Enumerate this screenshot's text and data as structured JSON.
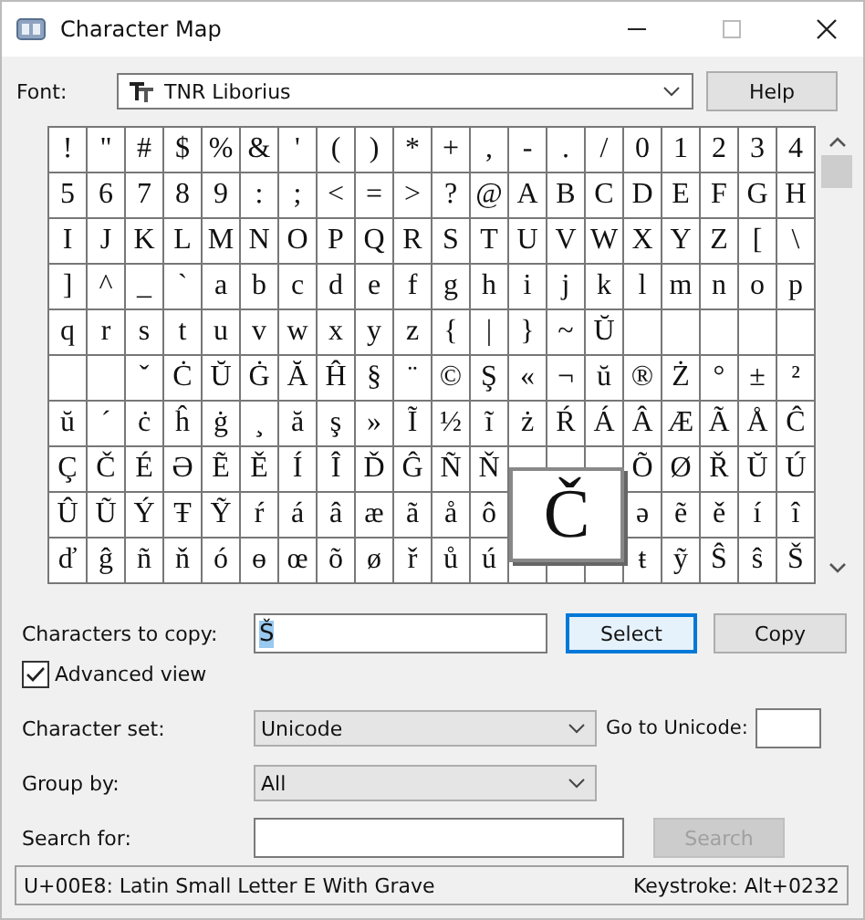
{
  "window": {
    "title": "Character Map"
  },
  "font": {
    "label": "Font:",
    "value": "TNR Liborius"
  },
  "help_button": {
    "label": "Help"
  },
  "grid": {
    "rows": [
      [
        "!",
        "\"",
        "#",
        "$",
        "%",
        "&",
        "'",
        "(",
        ")",
        "*",
        "+",
        ",",
        "-",
        ".",
        "/",
        "0",
        "1",
        "2",
        "3",
        "4"
      ],
      [
        "5",
        "6",
        "7",
        "8",
        "9",
        ":",
        ";",
        "<",
        "=",
        ">",
        "?",
        "@",
        "A",
        "B",
        "C",
        "D",
        "E",
        "F",
        "G",
        "H"
      ],
      [
        "I",
        "J",
        "K",
        "L",
        "M",
        "N",
        "O",
        "P",
        "Q",
        "R",
        "S",
        "T",
        "U",
        "V",
        "W",
        "X",
        "Y",
        "Z",
        "[",
        "\\"
      ],
      [
        "]",
        "^",
        "_",
        "`",
        "a",
        "b",
        "c",
        "d",
        "e",
        "f",
        "g",
        "h",
        "i",
        "j",
        "k",
        "l",
        "m",
        "n",
        "o",
        "p"
      ],
      [
        "q",
        "r",
        "s",
        "t",
        "u",
        "v",
        "w",
        "x",
        "y",
        "z",
        "{",
        "|",
        "}",
        "~",
        "Ŭ",
        null,
        null,
        null,
        null,
        null
      ],
      [
        null,
        null,
        "ˇ",
        "Ċ",
        "Ŭ",
        "Ġ",
        "Ă",
        "Ĥ",
        "§",
        "¨",
        "©",
        "Ş",
        "«",
        "¬",
        "ŭ",
        "®",
        "Ż",
        "°",
        "±",
        "²"
      ],
      [
        "ŭ",
        "´",
        "ċ",
        "ĥ",
        "ġ",
        "¸",
        "ă",
        "ş",
        "»",
        "Ĩ",
        "½",
        "ĩ",
        "ż",
        "Ŕ",
        "Á",
        "Â",
        "Æ",
        "Ã",
        "Å",
        "Ĉ"
      ],
      [
        "Ç",
        "Č",
        "É",
        "Ə",
        "Ẽ",
        "Ě",
        "Í",
        "Î",
        "Ď",
        "Ĝ",
        "Ñ",
        "Ň",
        null,
        null,
        null,
        "Õ",
        "Ø",
        "Ř",
        "Ŭ",
        "Ú"
      ],
      [
        "Û",
        "Ũ",
        "Ý",
        "Ŧ",
        "Ỹ",
        "ŕ",
        "á",
        "â",
        "æ",
        "ã",
        "å",
        "ô",
        null,
        null,
        null,
        "ə",
        "ẽ",
        "ě",
        "í",
        "î"
      ],
      [
        "ď",
        "ĝ",
        "ñ",
        "ň",
        "ó",
        "ɵ",
        "œ",
        "õ",
        "ø",
        "ř",
        "ů",
        "ú",
        null,
        null,
        null,
        "ŧ",
        "ỹ",
        "Ŝ",
        "ŝ",
        "Š"
      ]
    ],
    "popup": {
      "char": "Č"
    }
  },
  "characters_to_copy": {
    "label": "Characters to copy:",
    "value": "Š",
    "selected": true
  },
  "select_button": {
    "label": "Select",
    "focused": true
  },
  "copy_button": {
    "label": "Copy"
  },
  "advanced_view": {
    "label": "Advanced view",
    "checked": true
  },
  "character_set": {
    "label": "Character set:",
    "value": "Unicode"
  },
  "go_to_unicode": {
    "label": "Go to Unicode:"
  },
  "group_by": {
    "label": "Group by:",
    "value": "All"
  },
  "search": {
    "label": "Search for:",
    "button": {
      "label": "Search",
      "disabled": true
    }
  },
  "status_bar": {
    "description": "U+00E8: Latin Small Letter E With Grave",
    "keystroke": "Keystroke: Alt+0232"
  }
}
